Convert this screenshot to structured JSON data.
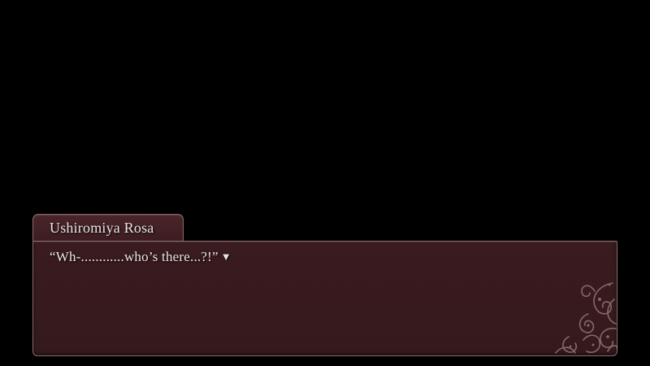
{
  "speaker": {
    "name": "Ushiromiya Rosa"
  },
  "dialogue": {
    "text": "“Wh-............who’s there...?!”",
    "advance_glyph": "▼"
  },
  "ornament": {
    "icon": "floral-flourish-icon"
  },
  "colors": {
    "background": "#000000",
    "box_fill": "#3a1b1f",
    "box_border": "#8a6a6c",
    "text": "#ece4e4"
  }
}
